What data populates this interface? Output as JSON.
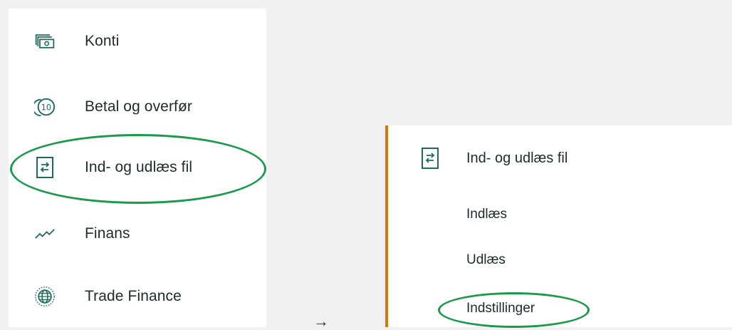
{
  "sidebar": {
    "items": [
      {
        "label": "Konti",
        "icon": "accounts-icon"
      },
      {
        "label": "Betal og overfør",
        "icon": "payment-coin-icon"
      },
      {
        "label": "Ind- og udlæs fil",
        "icon": "file-transfer-icon"
      },
      {
        "label": "Finans",
        "icon": "finance-chart-icon"
      },
      {
        "label": "Trade Finance",
        "icon": "globe-icon"
      }
    ]
  },
  "arrow": "→",
  "submenu": {
    "header": "Ind- og udlæs fil",
    "items": [
      "Indlæs",
      "Udlæs",
      "Indstillinger"
    ]
  },
  "colors": {
    "accent_border": "#d8750d",
    "highlight": "#1a9a4a",
    "icon_green": "#1f6b57"
  }
}
